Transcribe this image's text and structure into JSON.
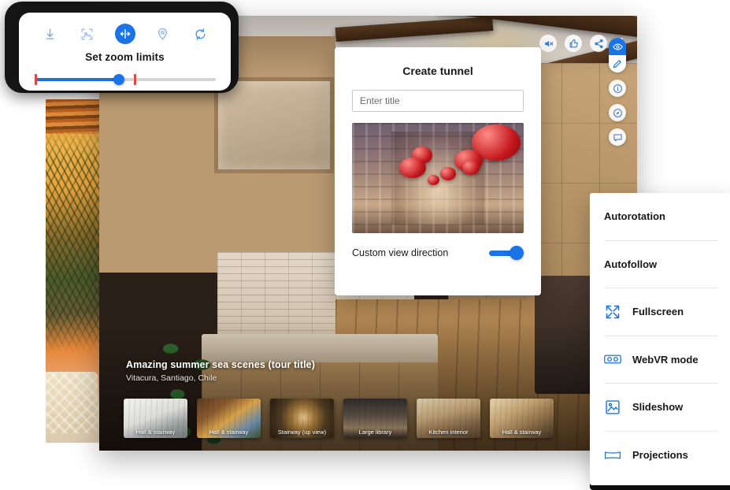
{
  "zoom_card": {
    "title": "Set zoom limits",
    "icons": [
      {
        "name": "download-icon",
        "label": "Download"
      },
      {
        "name": "crop-image-icon",
        "label": "Crop image"
      },
      {
        "name": "zoom-limits-icon",
        "label": "Set zoom limits",
        "active": true
      },
      {
        "name": "location-pin-icon",
        "label": "Location"
      },
      {
        "name": "refresh-icon",
        "label": "Reset"
      }
    ],
    "slider": {
      "value": 40,
      "min_limit": 0,
      "max_limit": 56,
      "accent": "#1a73e8",
      "limit_color": "#e8433c"
    }
  },
  "dialog": {
    "title": "Create tunnel",
    "input_placeholder": "Enter title",
    "input_value": "",
    "toggle_label": "Custom view direction",
    "toggle_on": true,
    "preview_alt": "market-hall-with-red-baubles"
  },
  "panorama": {
    "tour_title": "Amazing summer sea scenes (tour title)",
    "location": "Vitacura, Santiago, Chile",
    "top_icons": [
      {
        "name": "sound-muted-icon",
        "label": "Sound off"
      },
      {
        "name": "thumbs-up-icon",
        "label": "Like"
      },
      {
        "name": "share-icon",
        "label": "Share"
      },
      {
        "name": "more-options-icon",
        "label": "More"
      }
    ],
    "right_rail": [
      {
        "name": "eye-icon",
        "label": "View",
        "active": true
      },
      {
        "name": "pencil-icon",
        "label": "Edit",
        "active": false
      },
      {
        "name": "info-icon",
        "label": "Info",
        "active": false
      },
      {
        "name": "compass-icon",
        "label": "Compass",
        "active": false
      },
      {
        "name": "comment-icon",
        "label": "Comments",
        "active": false
      }
    ],
    "thumbnails": [
      {
        "caption": "Hall & stairway"
      },
      {
        "caption": "Hall & stairway"
      },
      {
        "caption": "Stairway (up view)"
      },
      {
        "caption": "Large library"
      },
      {
        "caption": "Kitchen interior"
      },
      {
        "caption": "Hall & stairway"
      }
    ]
  },
  "menu": {
    "items": [
      {
        "label": "Autorotation",
        "icon": null
      },
      {
        "label": "Autofollow",
        "icon": null
      },
      {
        "label": "Fullscreen",
        "icon": "fullscreen-icon"
      },
      {
        "label": "WebVR mode",
        "icon": "webvr-icon"
      },
      {
        "label": "Slideshow",
        "icon": "slideshow-icon"
      },
      {
        "label": "Projections",
        "icon": "projections-icon"
      }
    ]
  },
  "colors": {
    "accent": "#1a73e8",
    "limit": "#e8433c",
    "text": "#17181a"
  }
}
